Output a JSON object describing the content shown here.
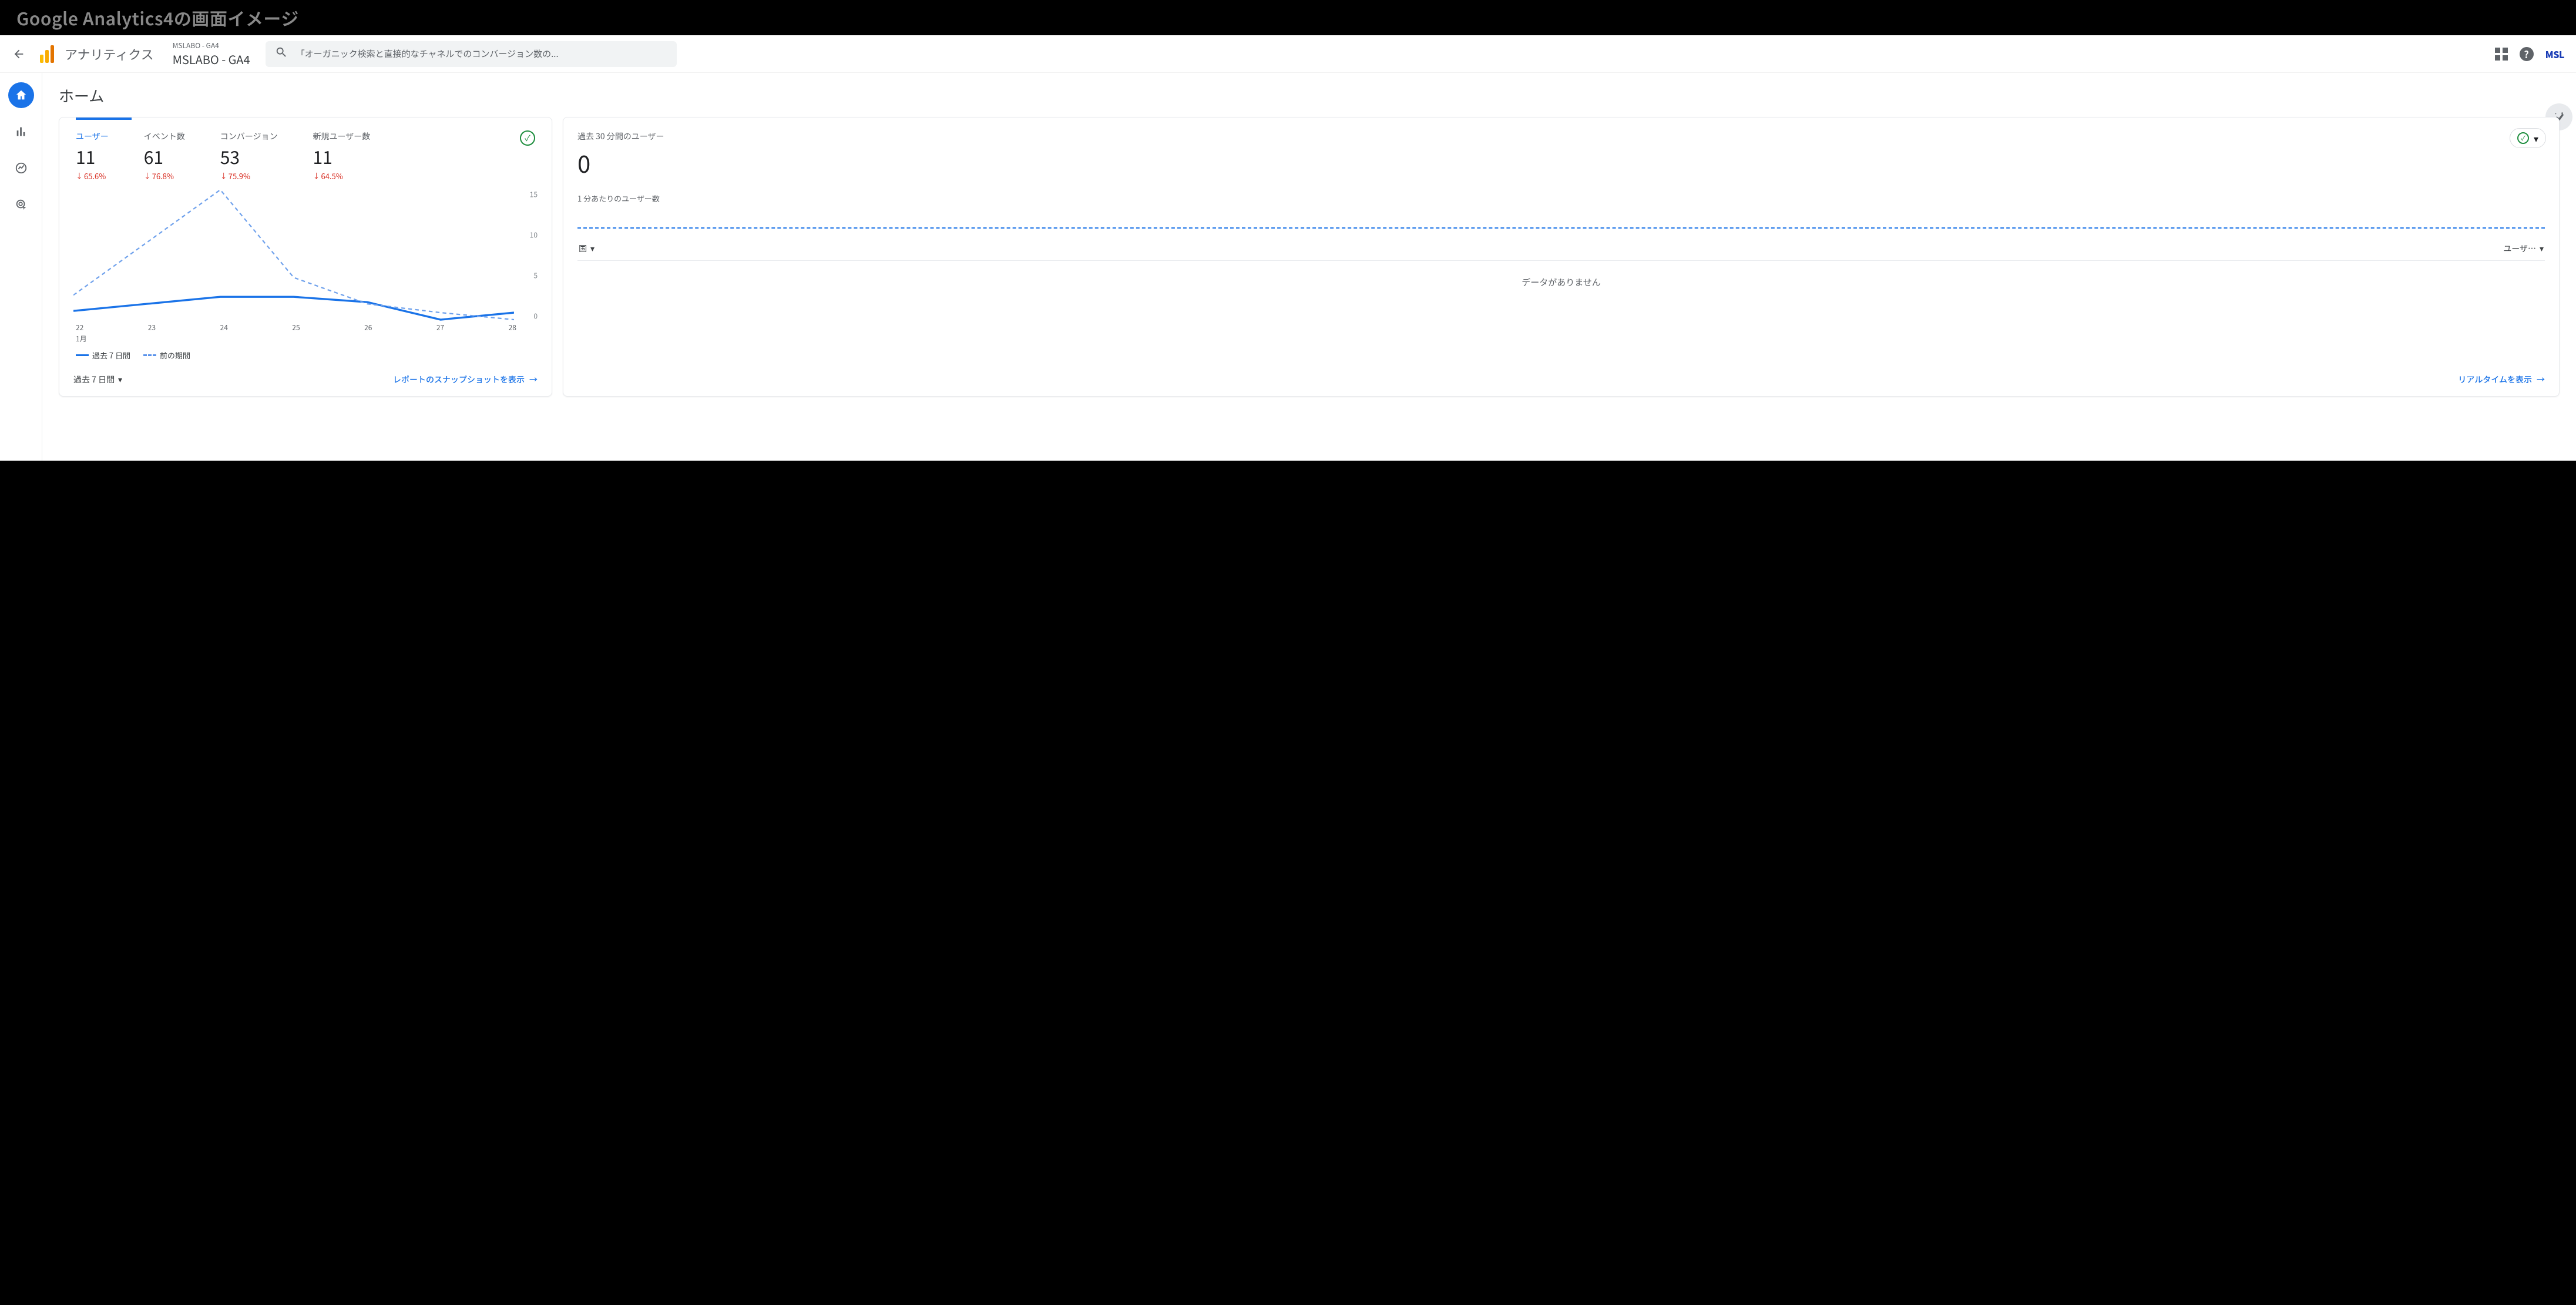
{
  "outer_title": "Google Analytics4の画面イメージ",
  "header": {
    "app_name": "アナリティクス",
    "property_sub": "MSLABO - GA4",
    "property_main": "MSLABO - GA4",
    "search_placeholder": "「オーガニック検索と直接的なチャネルでのコンバージョン数の...",
    "account_badge": "MSL"
  },
  "sidebar": {
    "items": [
      {
        "name": "home",
        "active": true
      },
      {
        "name": "reports",
        "active": false
      },
      {
        "name": "explore",
        "active": false
      },
      {
        "name": "advertising",
        "active": false
      }
    ]
  },
  "page": {
    "title": "ホーム"
  },
  "main_card": {
    "metrics": [
      {
        "label": "ユーザー",
        "value": "11",
        "delta": "65.6%",
        "direction": "down",
        "active": true
      },
      {
        "label": "イベント数",
        "value": "61",
        "delta": "76.8%",
        "direction": "down",
        "active": false
      },
      {
        "label": "コンバージョン",
        "value": "53",
        "delta": "75.9%",
        "direction": "down",
        "active": false
      },
      {
        "label": "新規ユーザー数",
        "value": "11",
        "delta": "64.5%",
        "direction": "down",
        "active": false
      }
    ],
    "y_ticks": [
      "15",
      "10",
      "5",
      "0"
    ],
    "x_ticks": [
      "22",
      "23",
      "24",
      "25",
      "26",
      "27",
      "28"
    ],
    "x_sublabel": "1月",
    "legend_current": "過去 7 日間",
    "legend_previous": "前の期間",
    "range_selector": "過去 7 日間",
    "footer_link": "レポートのスナップショットを表示"
  },
  "side_card": {
    "title": "過去 30 分間のユーザー",
    "big_value": "0",
    "subtitle": "1 分あたりのユーザー数",
    "dim_left": "国",
    "dim_right": "ユーザ…",
    "no_data": "データがありません",
    "footer_link": "リアルタイムを表示"
  },
  "chart_data": {
    "type": "line",
    "title": "ユーザー",
    "xlabel": "1月",
    "ylabel": "",
    "ylim": [
      0,
      15
    ],
    "categories": [
      "22",
      "23",
      "24",
      "25",
      "26",
      "27",
      "28"
    ],
    "series": [
      {
        "name": "過去 7 日間",
        "values": [
          1.2,
          2.0,
          2.8,
          2.8,
          2.2,
          0.2,
          1.0
        ]
      },
      {
        "name": "前の期間",
        "values": [
          3.0,
          9.0,
          15.0,
          5.0,
          2.0,
          1.0,
          0.2
        ]
      }
    ],
    "legend": [
      "過去 7 日間",
      "前の期間"
    ]
  }
}
